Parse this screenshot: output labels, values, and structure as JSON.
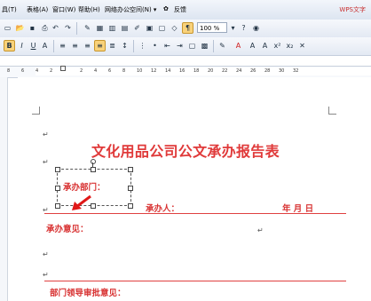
{
  "menu": {
    "items": [
      "具(T)",
      "表格(A)",
      "窗口(W)",
      "帮助(H)",
      "网络办公空间(N) ▾",
      "反馈"
    ],
    "brand": "WPS文字"
  },
  "zoom": "100 %",
  "ruler": {
    "numbers": [
      "8",
      "6",
      "4",
      "2",
      "2",
      "4",
      "6",
      "8",
      "10",
      "12",
      "14",
      "16",
      "18",
      "20",
      "22",
      "24",
      "26",
      "28",
      "30",
      "32"
    ]
  },
  "document": {
    "title": "文化用品公司公文承办报告表",
    "dept_label": "承办部门：",
    "handler_label": "承办人：",
    "date_label": "年   月   日",
    "opinion_label": "承办意见：",
    "leader_label": "部门领导审批意见："
  },
  "colors": {
    "accent_red": "#e03a3a",
    "toolbar_bg": "#e3e9f3"
  }
}
